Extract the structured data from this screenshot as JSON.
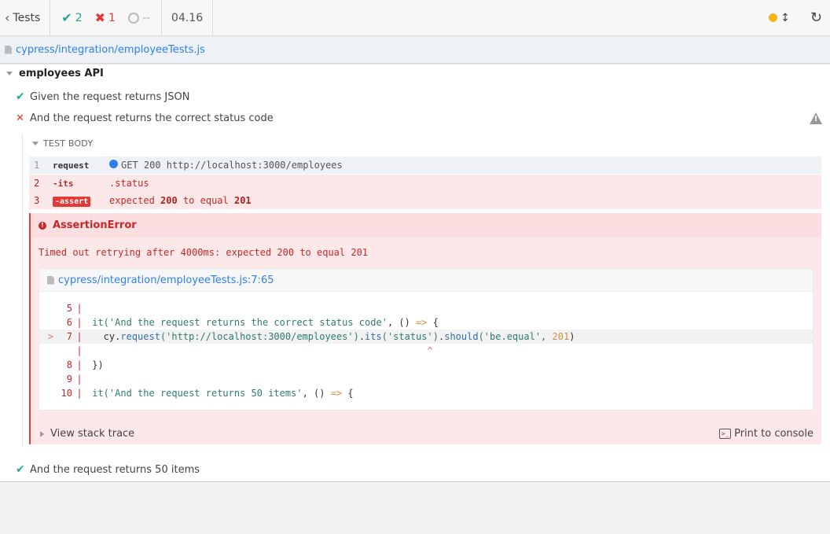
{
  "header": {
    "back_label": "Tests",
    "passed": "2",
    "failed": "1",
    "pending": "--",
    "duration": "04.16"
  },
  "file": {
    "path": "cypress/integration/employeeTests.js"
  },
  "suite": {
    "title": "employees API"
  },
  "tests": [
    {
      "title": "Given the request returns JSON",
      "state": "passed"
    },
    {
      "title": "And the request returns the correct status code",
      "state": "failed"
    },
    {
      "title": "And the request returns 50 items",
      "state": "passed"
    }
  ],
  "test_body": {
    "header": "TEST BODY",
    "commands": [
      {
        "num": "1",
        "name": "request",
        "message": "GET 200 http://localhost:3000/employees"
      },
      {
        "num": "2",
        "name": "-its",
        "message": ".status"
      },
      {
        "num": "3",
        "name": "-assert",
        "msg_a": "expected",
        "v1": "200",
        "msg_b": "to equal",
        "v2": "201"
      }
    ]
  },
  "error": {
    "name": "AssertionError",
    "message": "Timed out retrying after 4000ms: expected 200 to equal 201",
    "frame_link": "cypress/integration/employeeTests.js:7:65",
    "code": {
      "l5": "5",
      "l6": "6",
      "l6_a": "it(",
      "l6_str": "'And the request returns the correct status code'",
      "l6_b": ", () ",
      "l6_arrow": "=>",
      "l6_c": " {",
      "l7_marker": ">",
      "l7": "7",
      "l7_a": "  cy.",
      "l7_fn1": "request",
      "l7_s1": "('http://localhost:3000/employees')",
      "l7_dot1": ".",
      "l7_fn2": "its",
      "l7_s2": "('status')",
      "l7_dot2": ".",
      "l7_fn3": "should",
      "l7_s3": "('be.equal', ",
      "l7_num": "201",
      "l7_end": ")",
      "caret": "^",
      "l8": "8",
      "l8_src": "})",
      "l9": "9",
      "l10": "10",
      "l10_a": "it(",
      "l10_str": "'And the request returns 50 items'",
      "l10_b": ", () ",
      "l10_arrow": "=>",
      "l10_c": " {"
    },
    "stack_label": "View stack trace",
    "print_label": "Print to console"
  }
}
